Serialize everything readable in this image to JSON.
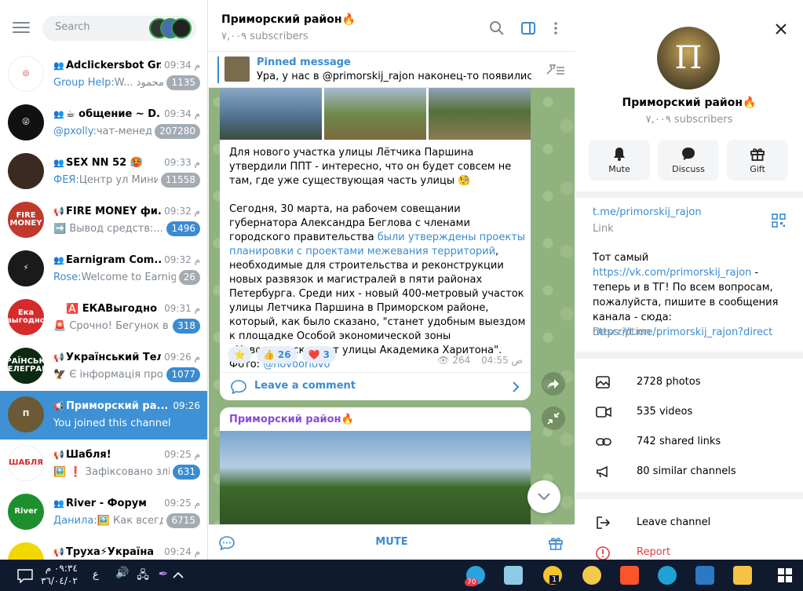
{
  "search": {
    "placeholder": "Search"
  },
  "chats": [
    {
      "type": "👥",
      "title": "Adclickersbot Gr...",
      "time": "09:34 م",
      "sender": "Group Help: ",
      "text": "W... محمود",
      "badge": "1135",
      "badge_muted": true
    },
    {
      "type": "👥",
      "title": "☕ общение ~ D...",
      "time": "09:34 م",
      "sender": "@pxolly: ",
      "text": "чат-менед...",
      "badge": "207280",
      "badge_muted": true
    },
    {
      "type": "👥",
      "title": "SEX NN 52 🥵",
      "time": "09:33 م",
      "sender": "ФЕЯ: ",
      "text": "Центр ул Мини...",
      "badge": "11558",
      "badge_muted": true
    },
    {
      "type": "📢",
      "title": "FIRE MONEY фи...",
      "time": "09:32 م",
      "sender": "",
      "text": "➡️ Вывод средств:...",
      "badge": "1496",
      "badge_muted": false
    },
    {
      "type": "👥",
      "title": "Earnigram Com...",
      "time": "09:32 م",
      "sender": "Rose: ",
      "text": "Welcome to Earnig...",
      "badge": "26",
      "badge_muted": true
    },
    {
      "type": "",
      "title": "🅰️ ЕКАВыгодно Ск...",
      "time": "09:31 م",
      "sender": "",
      "text": "🚨 Срочно! Бегунок в ...",
      "badge": "318",
      "badge_muted": false
    },
    {
      "type": "📢",
      "title": "Український Тел...",
      "time": "09:26 م",
      "sender": "",
      "text": "🦅 Є інформація про ...",
      "badge": "1077",
      "badge_muted": false
    },
    {
      "type": "📢",
      "title": "Приморский ра...",
      "time": "09:26",
      "sender": "",
      "text": "You joined this channel",
      "badge": "",
      "badge_muted": false
    },
    {
      "type": "📢",
      "title": "Шабля!",
      "time": "09:25 م",
      "sender": "",
      "text": "🖼️ ❗ Зафіксовано злі...",
      "badge": "631",
      "badge_muted": false
    },
    {
      "type": "👥",
      "title": "River - Форум",
      "time": "09:25 م",
      "sender": "Данила: ",
      "text": "🖼️ Как всегд...",
      "badge": "6715",
      "badge_muted": true
    },
    {
      "type": "📢",
      "title": "Труха⚡Україна",
      "time": "09:24 م",
      "sender": "",
      "text": "",
      "badge": "",
      "badge_muted": false
    }
  ],
  "avatars": [
    {
      "bg": "#ffffff",
      "label": "◎"
    },
    {
      "bg": "#111111",
      "label": "😜"
    },
    {
      "bg": "#3a2a22",
      "label": ""
    },
    {
      "bg": "#c0392b",
      "label": "FIRE MONEY"
    },
    {
      "bg": "#1a1a1a",
      "label": "⚡"
    },
    {
      "bg": "#d62b2b",
      "label": "Ека выгодно"
    },
    {
      "bg": "#0b2a12",
      "label": "УКРАЇНСЬКИЙ ТЕЛЕГРАМ"
    },
    {
      "bg": "#6b5a35",
      "label": "П"
    },
    {
      "bg": "#ffffff",
      "label": "ШАБЛЯ"
    },
    {
      "bg": "#1e8f2e",
      "label": "River"
    },
    {
      "bg": "#f1d800",
      "label": ""
    }
  ],
  "channel": {
    "title": "Приморский район🔥",
    "subscribers": "٧,٠٠٩ subscribers"
  },
  "pinned": {
    "label": "Pinned message",
    "text": "Ура, у нас в @primorskij_rajon наконец-то появились к..."
  },
  "post1": {
    "p1": "Для нового участка улицы Лётчика Паршина утвердили ППТ - интересно, что он будет совсем не там, где уже существующая часть улицы 🧐",
    "p2_before": "Сегодня, 30 марта, на рабочем совещании губернатора Александра Беглова с членами городского правительства ",
    "p2_link": "были утверждены проекты планировки с проектами межевания территорий",
    "p2_after": ", необходимые для строительства и реконструкции новых развязок и магистралей в пяти районах Петербурга. Среди них - новый 400-метровый участок улицы Летчика Паршина в Приморском районе, который, как было сказано, \"станет удобным выездом к площадке Особой экономической зоны «Новоорловская» от улицы Академика Харитона\".  Фото: ",
    "p2_handle": "@novoorlovo",
    "reactions": [
      {
        "emoji": "⭐",
        "count": ""
      },
      {
        "emoji": "👍",
        "count": "26"
      },
      {
        "emoji": "❤️",
        "count": "3"
      }
    ],
    "views": "264",
    "time": "04:55 ص",
    "comment_label": "Leave a comment"
  },
  "post2": {
    "author": "Приморский район🔥"
  },
  "footer": {
    "mute_label": "MUTE"
  },
  "profile": {
    "name": "Приморский район🔥",
    "subscribers": "٧,٠٠٩ subscribers",
    "actions": [
      {
        "label": "Mute",
        "icon": "bell-icon"
      },
      {
        "label": "Discuss",
        "icon": "chat-bubble-icon"
      },
      {
        "label": "Gift",
        "icon": "gift-icon"
      }
    ],
    "link": "t.me/primorskij_rajon",
    "link_label": "Link",
    "description_before": "Тот самый ",
    "description_link1": "https://vk.com/primorskij_rajon",
    "description_mid": " - теперь и в ТГ! По всем вопросам, пожалуйста, пишите в сообщения канала - сюда: ",
    "description_link2": "https://t.me/primorskij_rajon?direct",
    "description_label": "Description",
    "media": [
      {
        "label": "2728 photos",
        "icon": "photo-icon"
      },
      {
        "label": "535 videos",
        "icon": "video-icon"
      },
      {
        "label": "742 shared links",
        "icon": "link-icon"
      },
      {
        "label": "80 similar channels",
        "icon": "megaphone-icon"
      }
    ],
    "leave_label": "Leave channel",
    "report_label": "Report"
  },
  "taskbar": {
    "time": "٠٩:٣٤ م",
    "date": "٣٦/٠٤/٠٢",
    "lang": "ع",
    "telegram_badge": "70",
    "app_badge": "1"
  },
  "colors": {
    "accent": "#3a8bd1",
    "active_chat": "#3d91d4",
    "taskbar": "#0f1a2e"
  }
}
